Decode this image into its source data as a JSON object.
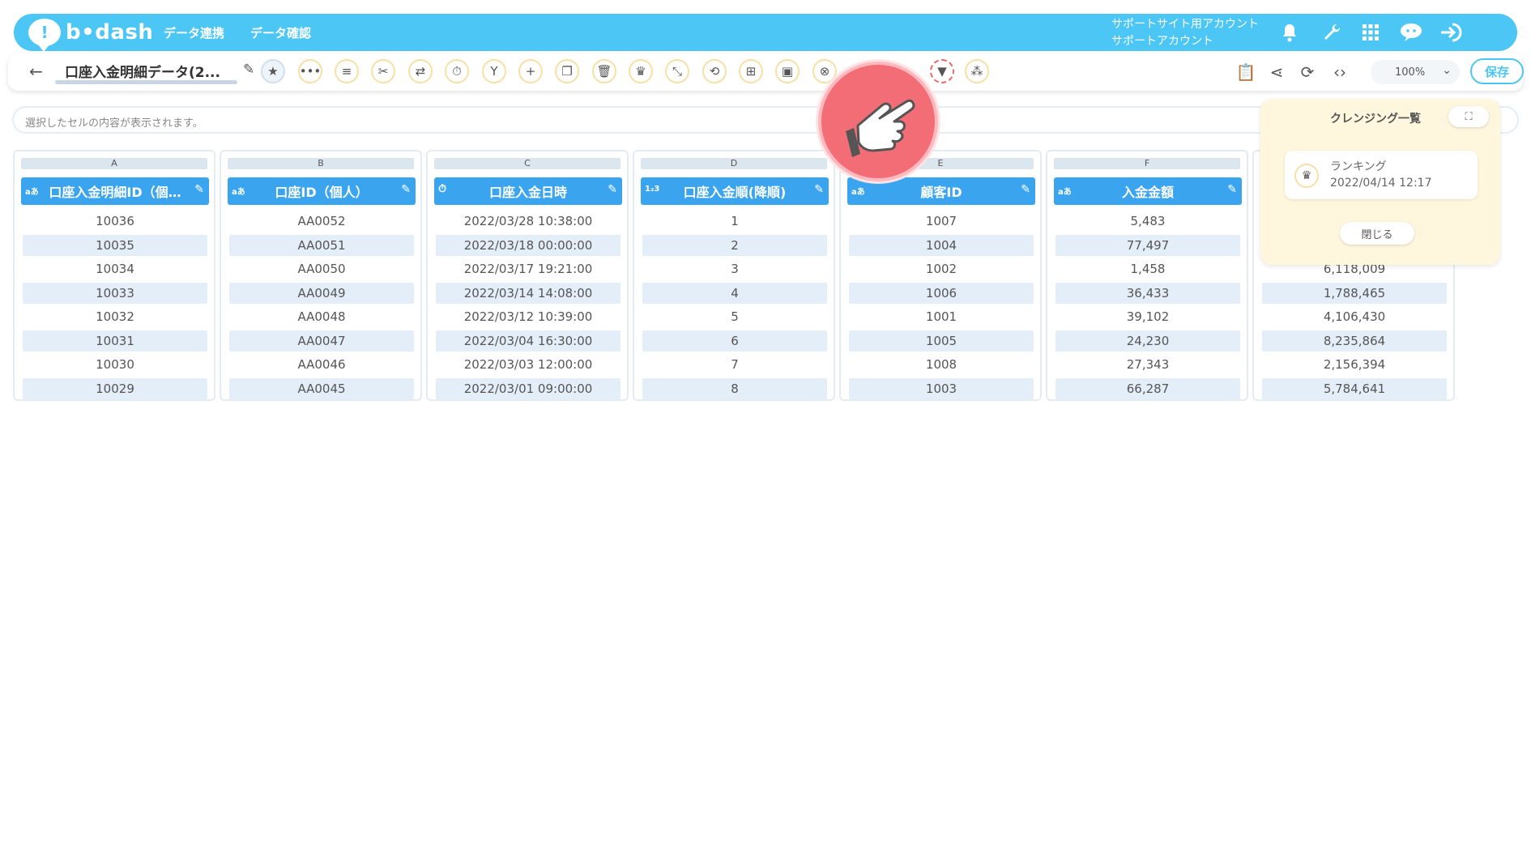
{
  "header": {
    "logo_text": "b•dash",
    "nav": [
      "データ連携",
      "データ確認"
    ],
    "account_line1": "サポートサイト用アカウント",
    "account_line2": "サポートアカウント"
  },
  "toolbar": {
    "title": "口座入金明細データ(2...",
    "zoom": "100%",
    "save_label": "保存"
  },
  "cellbar": {
    "placeholder": "選択したセルの内容が表示されます。"
  },
  "columns": [
    {
      "letter": "A",
      "type": "aあ",
      "name": "口座入金明細ID（個…",
      "cells": [
        "10036",
        "10035",
        "10034",
        "10033",
        "10032",
        "10031",
        "10030",
        "10029"
      ]
    },
    {
      "letter": "B",
      "type": "aあ",
      "name": "口座ID（個人）",
      "cells": [
        "AA0052",
        "AA0051",
        "AA0050",
        "AA0049",
        "AA0048",
        "AA0047",
        "AA0046",
        "AA0045"
      ]
    },
    {
      "letter": "C",
      "type": "⏱",
      "name": "口座入金日時",
      "cells": [
        "2022/03/28 10:38:00",
        "2022/03/18 00:00:00",
        "2022/03/17 19:21:00",
        "2022/03/14 14:08:00",
        "2022/03/12 10:39:00",
        "2022/03/04 16:30:00",
        "2022/03/03 12:00:00",
        "2022/03/01 09:00:00"
      ]
    },
    {
      "letter": "D",
      "type": "1₂3",
      "name": "口座入金順(降順)",
      "cells": [
        "1",
        "2",
        "3",
        "4",
        "5",
        "6",
        "7",
        "8"
      ]
    },
    {
      "letter": "E",
      "type": "aあ",
      "name": "顧客ID",
      "cells": [
        "1007",
        "1004",
        "1002",
        "1006",
        "1001",
        "1005",
        "1008",
        "1003"
      ]
    },
    {
      "letter": "F",
      "type": "aあ",
      "name": "入金金額",
      "cells": [
        "5,483",
        "77,497",
        "1,458",
        "36,433",
        "39,102",
        "24,230",
        "27,343",
        "66,287"
      ]
    },
    {
      "letter": "",
      "type": "",
      "name": "",
      "cells": [
        "",
        "",
        "6,118,009",
        "1,788,465",
        "4,106,430",
        "8,235,864",
        "2,156,394",
        "5,784,641"
      ]
    }
  ],
  "panel": {
    "title": "クレンジング一覧",
    "card_title": "ランキング",
    "card_date": "2022/04/14 12:17",
    "close_label": "閉じる"
  }
}
